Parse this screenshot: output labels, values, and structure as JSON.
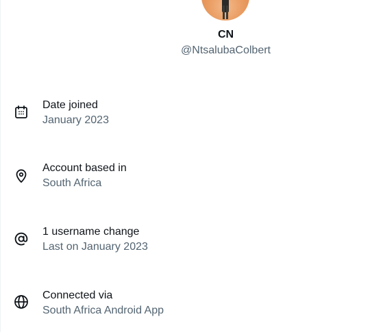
{
  "profile": {
    "display_name": "CN",
    "handle": "@NtsalubaColbert"
  },
  "about": {
    "items": [
      {
        "icon": "calendar-icon",
        "title": "Date joined",
        "value": "January 2023"
      },
      {
        "icon": "location-pin-icon",
        "title": "Account based in",
        "value": "South Africa"
      },
      {
        "icon": "at-sign-icon",
        "title": "1 username change",
        "value": "Last on January 2023"
      },
      {
        "icon": "globe-icon",
        "title": "Connected via",
        "value": "South Africa Android App"
      }
    ]
  },
  "colors": {
    "primary_text": "#0f1419",
    "secondary_text": "#536471",
    "background": "#ffffff"
  }
}
